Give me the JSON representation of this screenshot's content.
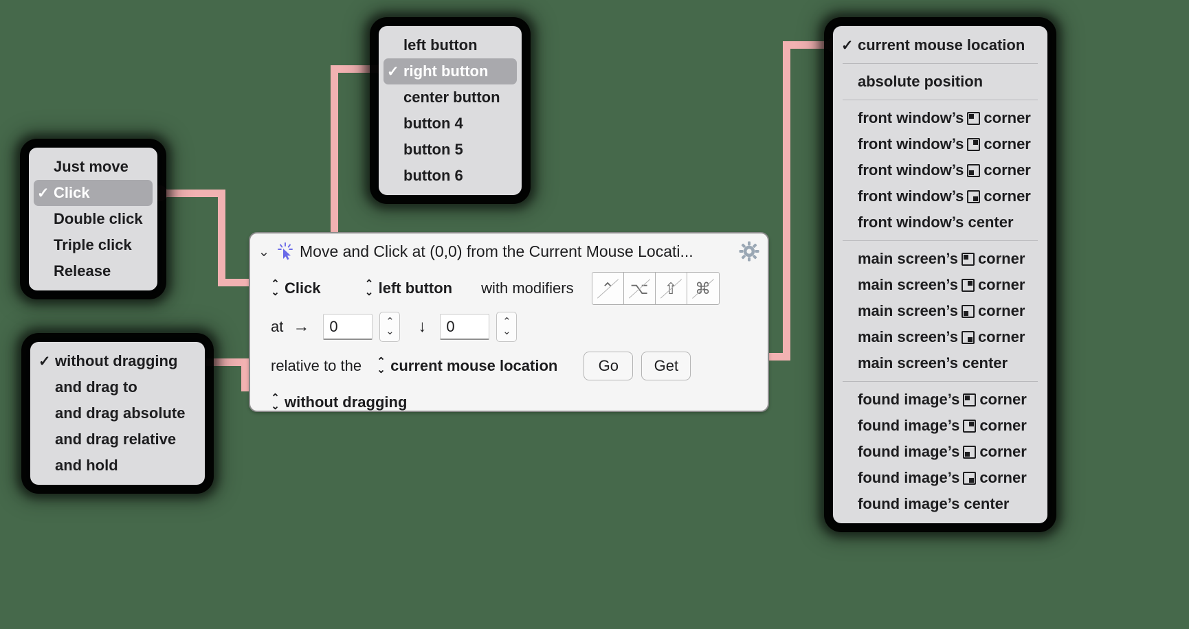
{
  "panel": {
    "title": "Move and Click at (0,0) from the Current Mouse Locati...",
    "disclosure": "⌄",
    "cursor_icon": "click-cursor-icon",
    "gear_icon": "gear-icon",
    "action_popup": "Click",
    "button_popup": "left button",
    "modifiers_label": "with modifiers",
    "modifier_keys": [
      {
        "name": "control",
        "glyph": "⌃",
        "enabled": false
      },
      {
        "name": "option",
        "glyph": "⌥",
        "enabled": false
      },
      {
        "name": "shift",
        "glyph": "⇧",
        "enabled": false
      },
      {
        "name": "command",
        "glyph": "⌘",
        "enabled": false
      }
    ],
    "at_label": "at",
    "x_arrow": "→",
    "x_value": "0",
    "y_arrow": "↓",
    "y_value": "0",
    "relative_label": "relative to the",
    "relative_popup": "current mouse location",
    "go_label": "Go",
    "get_label": "Get",
    "drag_popup": "without dragging"
  },
  "menu_action": {
    "name": "action-menu",
    "items": [
      {
        "label": "Just move",
        "checked": false,
        "selected": false
      },
      {
        "label": "Click",
        "checked": true,
        "selected": true
      },
      {
        "label": "Double click",
        "checked": false,
        "selected": false
      },
      {
        "label": "Triple click",
        "checked": false,
        "selected": false
      },
      {
        "label": "Release",
        "checked": false,
        "selected": false
      }
    ]
  },
  "menu_button": {
    "name": "mouse-button-menu",
    "items": [
      {
        "label": "left button",
        "checked": false,
        "selected": false
      },
      {
        "label": "right button",
        "checked": true,
        "selected": true
      },
      {
        "label": "center button",
        "checked": false,
        "selected": false
      },
      {
        "label": "button 4",
        "checked": false,
        "selected": false
      },
      {
        "label": "button 5",
        "checked": false,
        "selected": false
      },
      {
        "label": "button 6",
        "checked": false,
        "selected": false
      }
    ]
  },
  "menu_drag": {
    "name": "drag-menu",
    "items": [
      {
        "label": "without dragging",
        "checked": true,
        "selected": false
      },
      {
        "label": "and drag to",
        "checked": false,
        "selected": false
      },
      {
        "label": "and drag absolute",
        "checked": false,
        "selected": false
      },
      {
        "label": "and drag relative",
        "checked": false,
        "selected": false
      },
      {
        "label": "and hold",
        "checked": false,
        "selected": false
      }
    ]
  },
  "menu_relative": {
    "name": "relative-to-menu",
    "groups": [
      {
        "items": [
          {
            "pre": "current mouse location",
            "corner": null,
            "post": "",
            "checked": true
          }
        ]
      },
      {
        "items": [
          {
            "pre": "absolute position",
            "corner": null,
            "post": "",
            "checked": false
          }
        ]
      },
      {
        "items": [
          {
            "pre": "front window’s",
            "corner": "tl",
            "post": "corner",
            "checked": false
          },
          {
            "pre": "front window’s",
            "corner": "tr",
            "post": "corner",
            "checked": false
          },
          {
            "pre": "front window’s",
            "corner": "bl",
            "post": "corner",
            "checked": false
          },
          {
            "pre": "front window’s",
            "corner": "br",
            "post": "corner",
            "checked": false
          },
          {
            "pre": "front window’s center",
            "corner": null,
            "post": "",
            "checked": false
          }
        ]
      },
      {
        "items": [
          {
            "pre": "main screen’s",
            "corner": "tl",
            "post": "corner",
            "checked": false
          },
          {
            "pre": "main screen’s",
            "corner": "tr",
            "post": "corner",
            "checked": false
          },
          {
            "pre": "main screen’s",
            "corner": "bl",
            "post": "corner",
            "checked": false
          },
          {
            "pre": "main screen’s",
            "corner": "br",
            "post": "corner",
            "checked": false
          },
          {
            "pre": "main screen’s center",
            "corner": null,
            "post": "",
            "checked": false
          }
        ]
      },
      {
        "items": [
          {
            "pre": "found image’s",
            "corner": "tl",
            "post": "corner",
            "checked": false
          },
          {
            "pre": "found image’s",
            "corner": "tr",
            "post": "corner",
            "checked": false
          },
          {
            "pre": "found image’s",
            "corner": "bl",
            "post": "corner",
            "checked": false
          },
          {
            "pre": "found image’s",
            "corner": "br",
            "post": "corner",
            "checked": false
          },
          {
            "pre": "found image’s center",
            "corner": null,
            "post": "",
            "checked": false
          }
        ]
      }
    ]
  },
  "colors": {
    "wire": "#f2b2b2",
    "knob": "#f0aaaa",
    "menu_bg": "#dcdcde",
    "selected_bg": "#a9a9ad",
    "panel_bg": "#f5f5f5",
    "backdrop": "#46694b"
  }
}
